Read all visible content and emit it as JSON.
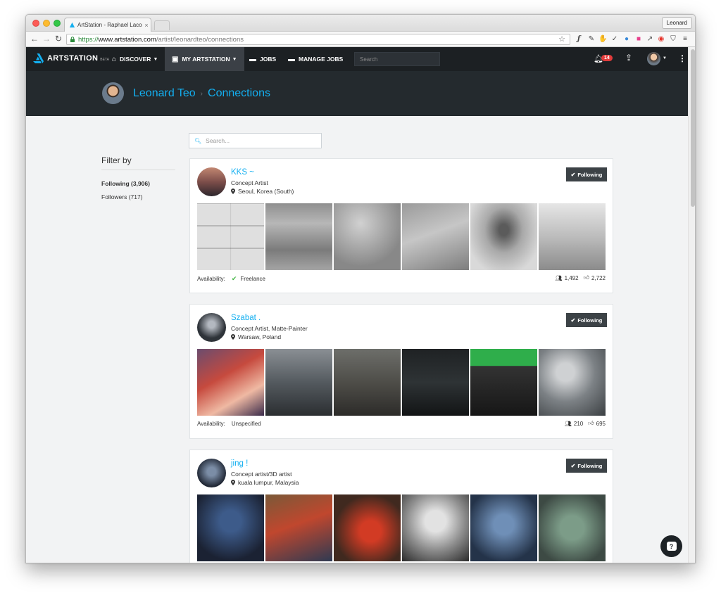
{
  "browser": {
    "tab_title": "ArtStation - Raphael Lacoste",
    "tab_close": "×",
    "profile_button": "Leonard",
    "url_scheme": "https://",
    "url_host": "www.artstation.com",
    "url_path": "/artist/leonardteo/connections"
  },
  "nav": {
    "logo_text": "ARTSTATION",
    "beta_label": "BETA",
    "discover_label": "DISCOVER",
    "my_artstation_label": "MY ARTSTATION",
    "jobs_label": "JOBS",
    "manage_jobs_label": "MANAGE JOBS",
    "search_placeholder": "Search",
    "notification_count": "14"
  },
  "header": {
    "user_name": "Leonard Teo",
    "separator": "›",
    "page_title": "Connections"
  },
  "search": {
    "placeholder": "Search..."
  },
  "sidebar": {
    "title": "Filter by",
    "following_label": "Following (3,906)",
    "followers_label": "Followers (717)"
  },
  "cards": [
    {
      "name": "KKS ~",
      "role": "Concept Artist",
      "location": "Seoul, Korea (South)",
      "follow_label": "Following",
      "availability_label": "Availability:",
      "availability": "Freelance",
      "followers": "1,492",
      "likes": "2,722"
    },
    {
      "name": "Szabat .",
      "role": "Concept Artist, Matte-Painter",
      "location": "Warsaw, Poland",
      "follow_label": "Following",
      "availability_label": "Availability:",
      "availability": "Unspecified",
      "followers": "210",
      "likes": "695"
    },
    {
      "name": "jing !",
      "role": "Concept artist/3D artist",
      "location": "kuala lumpur, Malaysia",
      "follow_label": "Following"
    }
  ],
  "help_icon_label": "?"
}
